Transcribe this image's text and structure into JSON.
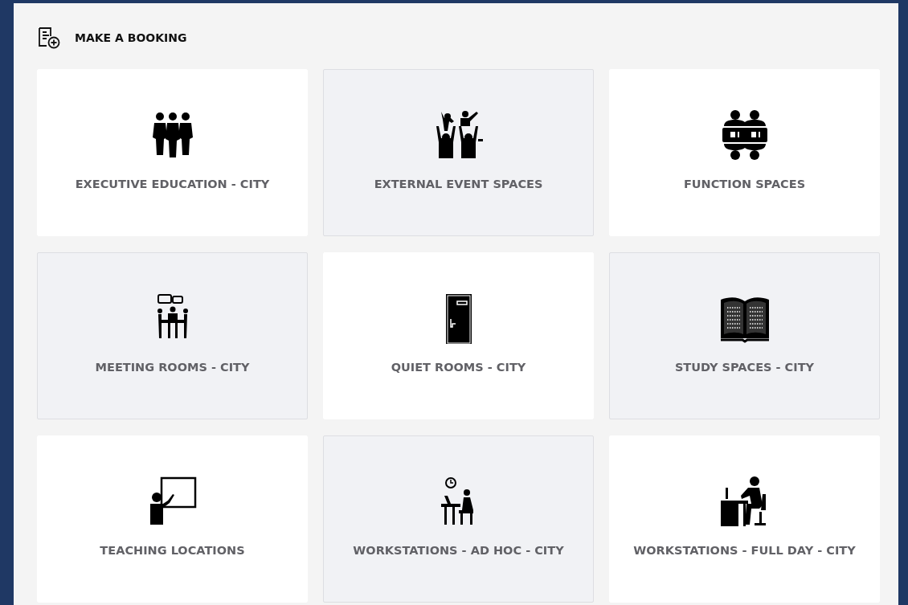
{
  "header": {
    "title": "MAKE A BOOKING"
  },
  "categories": [
    {
      "label": "EXECUTIVE EDUCATION - CITY",
      "kind": "group",
      "shaded": false
    },
    {
      "label": "EXTERNAL EVENT SPACES",
      "kind": "concert",
      "shaded": true
    },
    {
      "label": "FUNCTION SPACES",
      "kind": "table",
      "shaded": false
    },
    {
      "label": "MEETING ROOMS - CITY",
      "kind": "meeting",
      "shaded": true
    },
    {
      "label": "QUIET ROOMS - CITY",
      "kind": "door",
      "shaded": false
    },
    {
      "label": "STUDY SPACES - CITY",
      "kind": "book",
      "shaded": true
    },
    {
      "label": "TEACHING LOCATIONS",
      "kind": "teacher",
      "shaded": false
    },
    {
      "label": "WORKSTATIONS - AD HOC - CITY",
      "kind": "clockdesk",
      "shaded": true
    },
    {
      "label": "WORKSTATIONS - FULL DAY - CITY",
      "kind": "desk",
      "shaded": false
    }
  ]
}
